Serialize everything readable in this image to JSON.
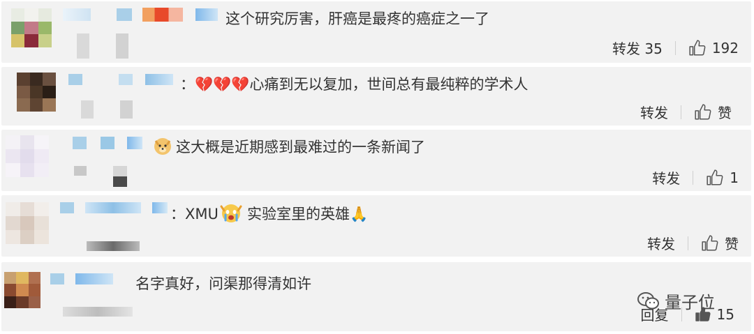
{
  "colors": {
    "card_bg": "#f2f2f2",
    "text": "#333333",
    "icon": "#555555",
    "nick_blur": "#a9cfe8"
  },
  "comments": [
    {
      "text": "这个研究厉害，肝癌是最疼的癌症之一了",
      "repost_label": "转发",
      "repost_count": "35",
      "like_label": "192"
    },
    {
      "text": "：💔💔💔心痛到无以复加，世间总有最纯粹的学术人",
      "repost_label": "转发",
      "like_label": "赞"
    },
    {
      "text": "这大概是近期感到最难过的一条新闻了",
      "emoji": "doge-emoji",
      "repost_label": "转发",
      "like_label": "1"
    },
    {
      "text_prefix": "：XMU",
      "text": "实验室里的英雄🙏",
      "emoji": "crying-face-emoji",
      "repost_label": "转发",
      "like_label": "赞"
    },
    {
      "text": "名字真好，问渠那得清如许",
      "reply_label": "回复",
      "like_label": "15"
    }
  ],
  "watermark": {
    "label": "量子位",
    "icon": "wechat-icon"
  }
}
